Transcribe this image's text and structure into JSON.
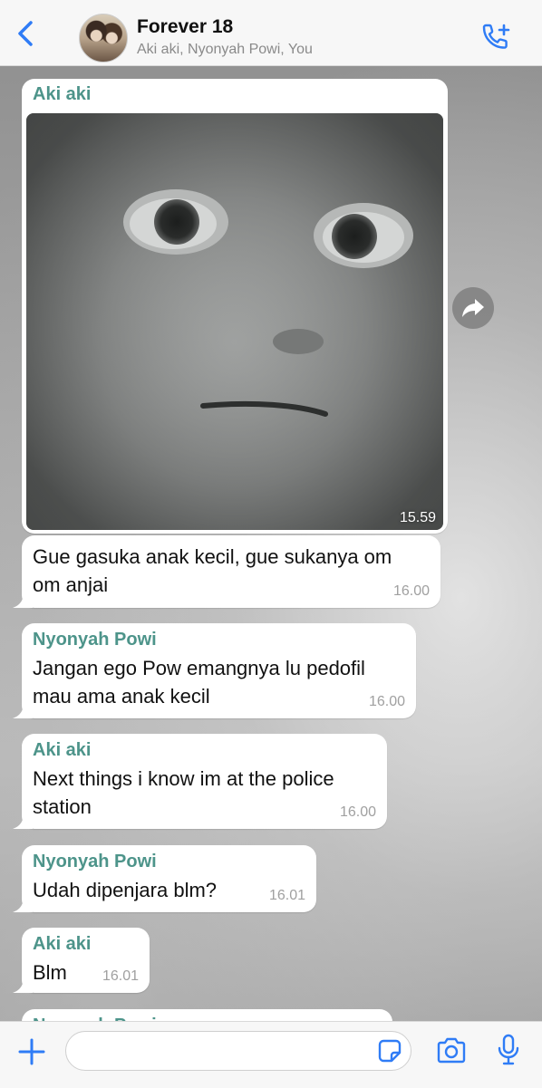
{
  "header": {
    "title": "Forever 18",
    "participants": "Aki aki, Nyonyah Powi, You"
  },
  "colors": {
    "accent": "#2f7cf6",
    "sender_name": "#4d948a",
    "bubble": "#ffffff"
  },
  "messages": [
    {
      "sender": "Aki aki",
      "type": "image",
      "time": "15.59"
    },
    {
      "sender": "",
      "lines": [
        "Gue gasuka anak kecil, gue sukanya om",
        "om anjai"
      ],
      "time": "16.00"
    },
    {
      "sender": "Nyonyah Powi",
      "lines": [
        "Jangan ego Pow emangnya lu pedofil",
        "mau ama anak kecil"
      ],
      "time": "16.00"
    },
    {
      "sender": "Aki aki",
      "lines": [
        "Next things i know im at the police",
        "station"
      ],
      "time": "16.00"
    },
    {
      "sender": "Nyonyah Powi",
      "lines": [
        "Udah dipenjara blm?"
      ],
      "time": "16.01"
    },
    {
      "sender": "Aki aki",
      "lines": [
        "Blm"
      ],
      "time": "16.01"
    },
    {
      "sender": "Nyonyah Powi",
      "lines": [],
      "time": ""
    }
  ],
  "icons": {
    "back": "chevron-left-icon",
    "add_call": "phone-plus-icon",
    "forward": "forward-arrow-icon",
    "plus": "plus-icon",
    "sticker": "sticker-icon",
    "camera": "camera-icon",
    "mic": "microphone-icon"
  },
  "composer": {
    "value": "",
    "placeholder": ""
  }
}
